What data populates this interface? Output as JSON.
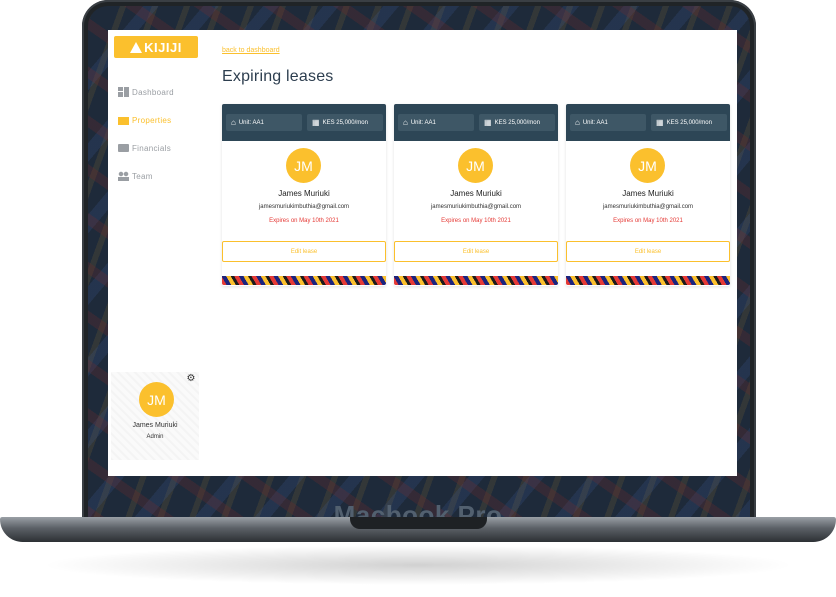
{
  "device": {
    "label": "Macbook Pro"
  },
  "app": {
    "brand": "KIJIJI"
  },
  "sidebar": {
    "items": [
      {
        "label": "Dashboard",
        "icon": "dashboard-icon",
        "active": false
      },
      {
        "label": "Properties",
        "icon": "building-icon",
        "active": true
      },
      {
        "label": "Financials",
        "icon": "briefcase-icon",
        "active": false
      },
      {
        "label": "Team",
        "icon": "team-icon",
        "active": false
      }
    ]
  },
  "profile": {
    "initials": "JM",
    "name": "James Muriuki",
    "role": "Admin",
    "settings_icon": "gear-icon"
  },
  "main": {
    "back_link": "back to dashboard",
    "title": "Expiring leases",
    "cards": [
      {
        "unit": "Unit: AA1",
        "rent": "KES 25,000/mon",
        "initials": "JM",
        "name": "James Muriuki",
        "email": "jamesmuriukimbuthia@gmail.com",
        "expiry": "Expires on May 10th 2021",
        "action": "Edit lease"
      },
      {
        "unit": "Unit: AA1",
        "rent": "KES 25,000/mon",
        "initials": "JM",
        "name": "James Muriuki",
        "email": "jamesmuriukimbuthia@gmail.com",
        "expiry": "Expires on May 10th 2021",
        "action": "Edit lease"
      },
      {
        "unit": "Unit: AA1",
        "rent": "KES 25,000/mon",
        "initials": "JM",
        "name": "James Muriuki",
        "email": "jamesmuriukimbuthia@gmail.com",
        "expiry": "Expires on May 10th 2021",
        "action": "Edit lease"
      }
    ]
  },
  "colors": {
    "accent": "#fbc02d",
    "header": "#2d4656",
    "danger": "#e53935",
    "title": "#2d3e4f"
  }
}
